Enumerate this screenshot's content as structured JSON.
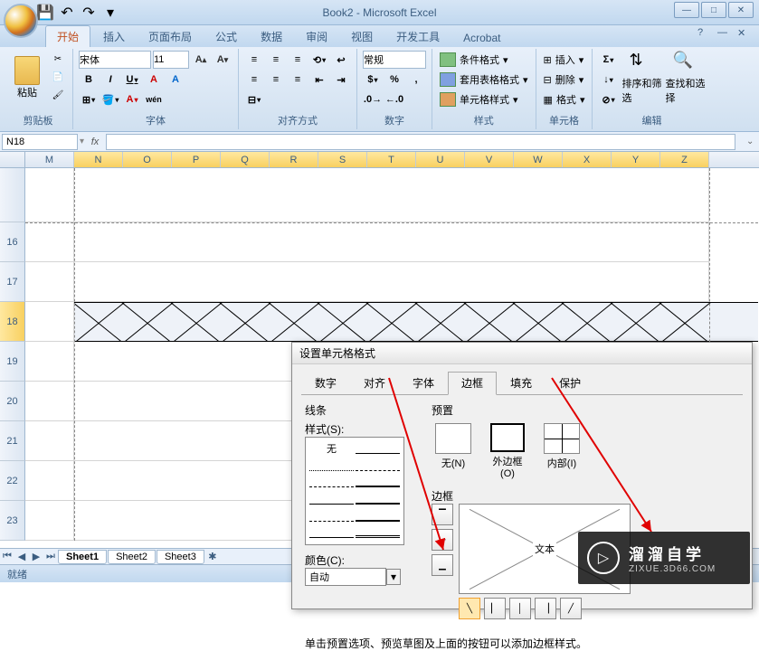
{
  "app": {
    "title": "Book2 - Microsoft Excel"
  },
  "tabs": [
    "开始",
    "插入",
    "页面布局",
    "公式",
    "数据",
    "审阅",
    "视图",
    "开发工具",
    "Acrobat"
  ],
  "active_tab": 0,
  "ribbon": {
    "clipboard": {
      "paste": "粘贴",
      "label": "剪贴板"
    },
    "font": {
      "name": "宋体",
      "size": "11",
      "bold": "B",
      "italic": "I",
      "underline": "U",
      "grow": "A",
      "shrink": "A",
      "label": "字体"
    },
    "alignment": {
      "label": "对齐方式"
    },
    "number": {
      "format": "常规",
      "label": "数字"
    },
    "styles": {
      "cond": "条件格式",
      "table": "套用表格格式",
      "cell": "单元格样式",
      "label": "样式"
    },
    "cells": {
      "insert": "插入",
      "delete": "删除",
      "format": "格式",
      "label": "单元格"
    },
    "editing": {
      "sort": "排序和筛选",
      "find": "查找和选择",
      "label": "编辑"
    }
  },
  "namebox": "N18",
  "columns": [
    "M",
    "N",
    "O",
    "P",
    "Q",
    "R",
    "S",
    "T",
    "U",
    "V",
    "W",
    "X",
    "Y",
    "Z"
  ],
  "rows": [
    "16",
    "17",
    "18",
    "19",
    "20",
    "21",
    "22",
    "23"
  ],
  "sheets": [
    "Sheet1",
    "Sheet2",
    "Sheet3"
  ],
  "status": "就绪",
  "dialog": {
    "title": "设置单元格格式",
    "tabs": [
      "数字",
      "对齐",
      "字体",
      "边框",
      "填充",
      "保护"
    ],
    "active_tab": 3,
    "line_label": "线条",
    "style_label": "样式(S):",
    "none_label": "无",
    "color_label": "颜色(C):",
    "color_value": "自动",
    "preset_label": "预置",
    "presets": {
      "none": "无(N)",
      "outline": "外边框(O)",
      "inside": "内部(I)"
    },
    "border_label": "边框",
    "preview_text": "文本",
    "help": "单击预置选项、预览草图及上面的按钮可以添加边框样式。"
  },
  "watermark": {
    "title": "溜溜自学",
    "sub": "ZIXUE.3D66.COM"
  }
}
